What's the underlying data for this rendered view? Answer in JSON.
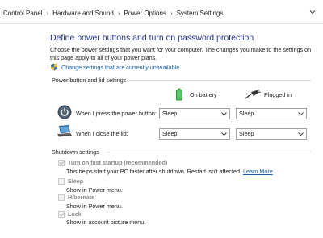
{
  "breadcrumb": {
    "items": [
      "Control Panel",
      "Hardware and Sound",
      "Power Options",
      "System Settings"
    ],
    "separator": "›"
  },
  "main": {
    "title": "Define power buttons and turn on password protection",
    "description": "Choose the power settings that you want for your computer. The changes you make to the settings on this page apply to all of your power plans.",
    "change_link": "Change settings that are currently unavailable"
  },
  "power_section": {
    "title": "Power button and lid settings",
    "columns": {
      "battery": "On battery",
      "plugged": "Plugged in"
    },
    "rows": [
      {
        "label": "When I press the power button:",
        "battery": "Sleep",
        "plugged": "Sleep"
      },
      {
        "label": "When I close the lid:",
        "battery": "Sleep",
        "plugged": "Sleep"
      }
    ]
  },
  "shutdown_section": {
    "title": "Shutdown settings",
    "items": [
      {
        "label": "Turn on fast startup (recommended)",
        "desc": "This helps start your PC faster after shutdown. Restart isn't affected.",
        "link": "Learn More",
        "checked": true
      },
      {
        "label": "Sleep",
        "desc": "Show in Power menu.",
        "checked": false
      },
      {
        "label": "Hibernate",
        "desc": "Show in Power menu.",
        "checked": false
      },
      {
        "label": "Lock",
        "desc": "Show in account picture menu.",
        "checked": true
      }
    ]
  },
  "colors": {
    "title": "#1e3287",
    "link": "#1a5ea8",
    "battery_green": "#2e9e3a"
  },
  "icons": [
    "chevron-right-icon",
    "chevron-down-icon",
    "uac-shield-icon",
    "battery-icon",
    "power-plug-icon",
    "power-button-icon",
    "laptop-lid-icon",
    "dropdown-arrow-icon",
    "checkbox-icon"
  ]
}
